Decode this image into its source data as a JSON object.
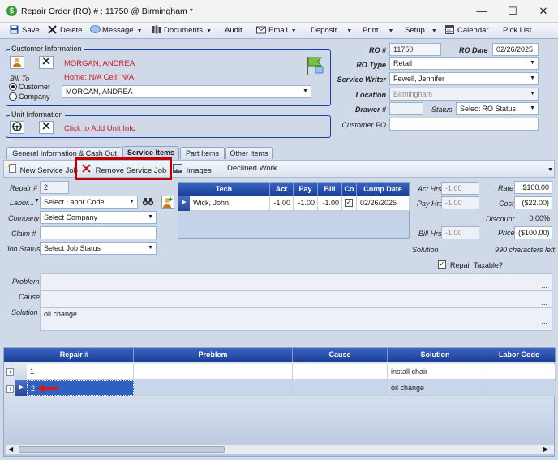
{
  "window": {
    "title": "Repair Order (RO) # : 11750 @ Birmingham *",
    "min": "—",
    "max": "☐",
    "close": "✕"
  },
  "toolbar": {
    "save": "Save",
    "delete": "Delete",
    "message": "Message",
    "documents": "Documents",
    "audit": "Audit",
    "email": "Email",
    "deposit": "Deposit",
    "print": "Print",
    "setup": "Setup",
    "calendar": "Calendar",
    "pick_list": "Pick List"
  },
  "customer": {
    "legend": "Customer Information",
    "name": "MORGAN, ANDREA",
    "phones": "Home: N/A Cell: N/A",
    "bill_to_label": "Bill To",
    "opt_customer": "Customer",
    "opt_company": "Company",
    "selected": "MORGAN, ANDREA"
  },
  "unit": {
    "legend": "Unit Information",
    "link": "Click to Add Unit Info"
  },
  "ro": {
    "ro_num_label": "RO #",
    "ro_num": "11750",
    "ro_date_label": "RO Date",
    "ro_date": "02/26/2025",
    "ro_type_label": "RO Type",
    "ro_type": "Retail",
    "writer_label": "Service Writer",
    "writer": "Fewell, Jennifer",
    "location_label": "Location",
    "location": "Birmingham",
    "drawer_label": "Drawer #",
    "drawer": "",
    "status_label": "Status",
    "status": "Select RO Status",
    "po_label": "Customer PO",
    "po": ""
  },
  "tabs": [
    "General Information & Cash Out",
    "Service Items",
    "Part Items",
    "Other Items"
  ],
  "subtoolbar": {
    "new_job": "New Service Job",
    "remove_job": "Remove Service Job",
    "images": "Images",
    "declined": "Declined Work"
  },
  "job": {
    "repair_label": "Repair #",
    "repair": "2",
    "labor_label": "Labor...",
    "labor": "Select Labor Code",
    "company_label": "Company",
    "company": "Select Company",
    "claim_label": "Claim #",
    "claim": "",
    "status_label": "Job Status",
    "status": "Select Job Status",
    "problem_label": "Problem",
    "problem": "",
    "cause_label": "Cause",
    "cause": "",
    "solution_label": "Solution",
    "solution": "oil change",
    "ellipsis": "..."
  },
  "tech_grid": {
    "headers": [
      "Tech",
      "Act",
      "Pay",
      "Bill",
      "Co",
      "Comp Date"
    ],
    "row": {
      "tech": "Wick, John",
      "act": "-1.00",
      "pay": "-1.00",
      "bill": "-1.00",
      "co": "✓",
      "date": "02/26/2025"
    }
  },
  "hours": {
    "act_label": "Act Hrs",
    "act": "-1.00",
    "pay_label": "Pay Hrs",
    "pay": "-1.00",
    "bill_label": "Bill Hrs",
    "bill": "-1.00"
  },
  "pricing": {
    "rate_label": "Rate",
    "rate": "$100.00",
    "cost_label": "Cost",
    "cost": "($22.00)",
    "discount_label": "Discount",
    "discount": "0.00%",
    "price_label": "Price",
    "price": "($100.00)",
    "solution_label": "Solution",
    "chars_left": "990 characters left",
    "taxable_label": "Repair Taxable?",
    "taxable_check": "✓"
  },
  "repairs_grid": {
    "headers": [
      "Repair #",
      "Problem",
      "Cause",
      "Solution",
      "Labor Code"
    ],
    "rows": [
      {
        "repair": "1",
        "problem": "",
        "cause": "",
        "solution": "install chair",
        "labor": ""
      },
      {
        "repair": "2",
        "problem": "",
        "cause": "",
        "solution": "oil change",
        "labor": ""
      }
    ]
  },
  "colors": {
    "highlight_box": "#c00000",
    "grid_header": "#1c3f95",
    "legend_border": "#1b3fa6"
  }
}
